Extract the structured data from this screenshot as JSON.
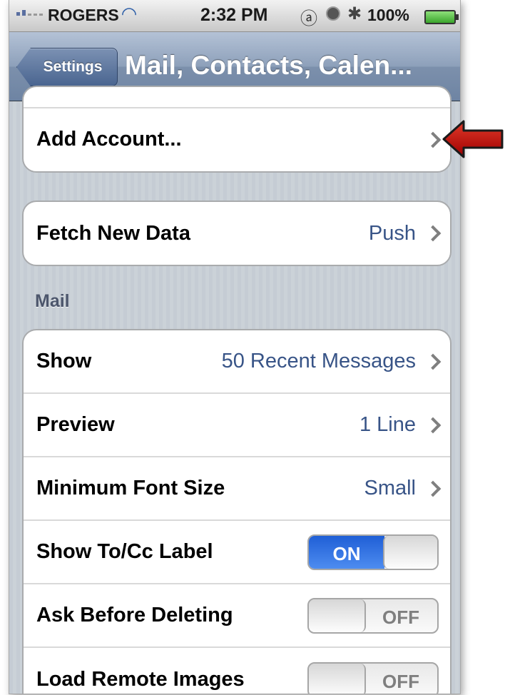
{
  "status_bar": {
    "carrier": "ROGERS",
    "time": "2:32 PM",
    "battery": "100%",
    "icons": [
      "signal-icon",
      "wifi-icon",
      "rotation-lock-icon",
      "alarm-icon",
      "bluetooth-icon",
      "battery-icon"
    ]
  },
  "nav": {
    "back_label": "Settings",
    "title": "Mail, Contacts, Calen..."
  },
  "accounts_group": {
    "add_account": "Add Account..."
  },
  "fetch_group": {
    "label": "Fetch New Data",
    "value": "Push"
  },
  "mail_section": {
    "header": "Mail",
    "rows": [
      {
        "label": "Show",
        "value": "50 Recent Messages"
      },
      {
        "label": "Preview",
        "value": "1 Line"
      },
      {
        "label": "Minimum Font Size",
        "value": "Small"
      }
    ],
    "toggles": [
      {
        "label": "Show To/Cc Label",
        "state": "ON"
      },
      {
        "label": "Ask Before Deleting",
        "state": "OFF"
      },
      {
        "label": "Load Remote Images",
        "state": "OFF"
      }
    ]
  },
  "colors": {
    "nav_bar": "#7c90ac",
    "value_text": "#385487",
    "toggle_on": "#2f6fe0",
    "arrow": "#c00000"
  }
}
